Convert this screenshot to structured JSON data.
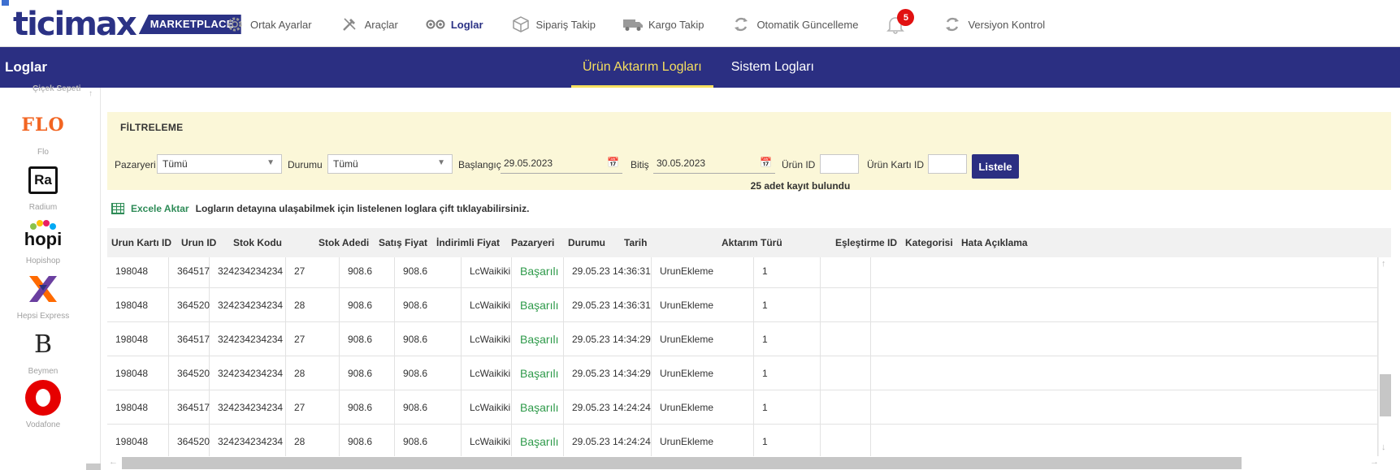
{
  "brand": {
    "word": "ticimax",
    "badge": "MARKETPLACE"
  },
  "nav": [
    {
      "label": "Ortak Ayarlar",
      "icon": "gear-icon"
    },
    {
      "label": "Araçlar",
      "icon": "tools-icon"
    },
    {
      "label": "Loglar",
      "icon": "eye-icon",
      "active": true
    },
    {
      "label": "Sipariş Takip",
      "icon": "box-icon"
    },
    {
      "label": "Kargo Takip",
      "icon": "truck-icon"
    },
    {
      "label": "Otomatik Güncelleme",
      "icon": "refresh-icon"
    },
    {
      "label": "Versiyon Kontrol",
      "icon": "refresh-icon"
    }
  ],
  "notifications": {
    "count": "5"
  },
  "header": {
    "title": "Loglar"
  },
  "tabs": [
    {
      "label": "Ürün Aktarım Logları",
      "active": true
    },
    {
      "label": "Sistem Logları",
      "active": false
    }
  ],
  "sidebar": {
    "cut_label": "Çiçek Sepeti",
    "items": [
      {
        "label": "Flo",
        "logo_text": "FLO"
      },
      {
        "label": "Radium",
        "logo_text": "Ra"
      },
      {
        "label": "Hopishop",
        "logo_text": "hopi"
      },
      {
        "label": "Hepsi Express",
        "logo_text": "X"
      },
      {
        "label": "Beymen",
        "logo_text": "B"
      },
      {
        "label": "Vodafone",
        "logo_text": ""
      }
    ]
  },
  "filter": {
    "title": "FİLTRELEME",
    "pazaryeri_label": "Pazaryeri",
    "pazaryeri_value": "Tümü",
    "durumu_label": "Durumu",
    "durumu_value": "Tümü",
    "baslangic_label": "Başlangıç",
    "baslangic_value": "29.05.2023",
    "bitis_label": "Bitiş",
    "bitis_value": "30.05.2023",
    "urun_id_label": "Ürün ID",
    "urun_karti_id_label": "Ürün Kartı ID",
    "list_button": "Listele",
    "result_count": "25 adet kayıt bulundu"
  },
  "excel": {
    "link": "Excele Aktar",
    "note": "Logların detayına ulaşabilmek için listelenen loglara çift tıklayabilirsiniz."
  },
  "table": {
    "columns": [
      "Urun Kartı ID",
      "Urun ID",
      "Stok Kodu",
      "Stok Adedi",
      "Satış Fiyat",
      "İndirimli Fiyat",
      "Pazaryeri",
      "Durumu",
      "Tarih",
      "Aktarım Türü",
      "Eşleştirme ID",
      "Kategorisi",
      "Hata Açıklama"
    ],
    "rows": [
      [
        "198048",
        "364517",
        "324234234234",
        "27",
        "908.6",
        "908.6",
        "LcWaikiki",
        "Başarılı",
        "29.05.23 14:36:31",
        "UrunEkleme",
        "1",
        "",
        ""
      ],
      [
        "198048",
        "364520",
        "324234234234",
        "28",
        "908.6",
        "908.6",
        "LcWaikiki",
        "Başarılı",
        "29.05.23 14:36:31",
        "UrunEkleme",
        "1",
        "",
        ""
      ],
      [
        "198048",
        "364517",
        "324234234234",
        "27",
        "908.6",
        "908.6",
        "LcWaikiki",
        "Başarılı",
        "29.05.23 14:34:29",
        "UrunEkleme",
        "1",
        "",
        ""
      ],
      [
        "198048",
        "364520",
        "324234234234",
        "28",
        "908.6",
        "908.6",
        "LcWaikiki",
        "Başarılı",
        "29.05.23 14:34:29",
        "UrunEkleme",
        "1",
        "",
        ""
      ],
      [
        "198048",
        "364517",
        "324234234234",
        "27",
        "908.6",
        "908.6",
        "LcWaikiki",
        "Başarılı",
        "29.05.23 14:24:24",
        "UrunEkleme",
        "1",
        "",
        ""
      ],
      [
        "198048",
        "364520",
        "324234234234",
        "28",
        "908.6",
        "908.6",
        "LcWaikiki",
        "Başarılı",
        "29.05.23 14:24:24",
        "UrunEkleme",
        "1",
        "",
        ""
      ]
    ]
  },
  "colors": {
    "brand": "#2b2f82",
    "tab_active": "#f6df5f",
    "filter_bg": "#fbf7d8",
    "success": "#2e9a4a",
    "badge": "#e11111"
  }
}
